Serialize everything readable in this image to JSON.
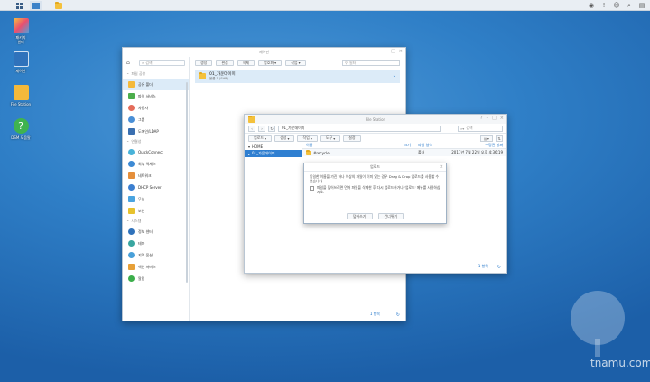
{
  "taskbar": {
    "main_menu_icon": "grid-icon",
    "app_icon": "folder-icon",
    "right_icons": [
      "chat-icon",
      "notification-icon",
      "user-icon",
      "search-icon",
      "widget-icon"
    ]
  },
  "desktop": {
    "icons": [
      {
        "label": "패키지\n센터",
        "icon": "package-center-icon"
      },
      {
        "label": "제어판",
        "icon": "control-panel-icon"
      },
      {
        "label": "File Station",
        "icon": "file-station-icon"
      },
      {
        "label": "DSM 도움말",
        "icon": "help-icon"
      }
    ],
    "watermark": "tnamu.com"
  },
  "control_panel": {
    "title": "제어판",
    "search_placeholder": "검색",
    "sections": [
      {
        "label": "파일 공유",
        "items": [
          "공유 폴더",
          "파일 서비스",
          "사용자",
          "그룹",
          "도메인/LDAP"
        ]
      },
      {
        "label": "연결성",
        "items": [
          "QuickConnect",
          "외부 액세스",
          "네트워크",
          "DHCP Server",
          "무선",
          "보안"
        ]
      },
      {
        "label": "시스템",
        "items": [
          "정보 센터",
          "테마",
          "지역 옵션",
          "색인 서비스",
          "알림"
        ]
      }
    ],
    "active_item": "공유 폴더",
    "toolbar": {
      "create": "생성",
      "edit": "편집",
      "delete": "삭제",
      "encrypt": "암호화",
      "action": "작업"
    },
    "filter_placeholder": "필터",
    "share": {
      "name": "01_가운데이미",
      "sub": "볼륨 1 (SHR)"
    },
    "pager": "1 항목"
  },
  "file_station": {
    "title": "File Station",
    "path": "01_가운데이미",
    "search_placeholder": "검색",
    "toolbar": {
      "upload": "업로드",
      "create": "생성",
      "action": "작업",
      "tools": "도구",
      "settings": "설정"
    },
    "tree": {
      "root": "HOME",
      "selected": "01_가운데이미"
    },
    "columns": {
      "name": "이름",
      "size": "크기",
      "type": "파일 형식",
      "modified": "수정된 날짜"
    },
    "rows": [
      {
        "name": "#recycle",
        "size": "",
        "type": "폴더",
        "modified": "2017년 7월 22일 오후 4:36:19"
      }
    ],
    "pager": "1 항목"
  },
  "dialog": {
    "title": "업로드",
    "message": "동일한 이름을 가진 하나 이상의 파일이 이미 있는 경우 Drag & Drop 업로드를 사용할 수 없습니다.",
    "checkbox_label": "파일을 덮어쓰려면 먼저 파일을 삭제한 후 다시 업로드하거나 '업로드' 메뉴를 사용하십시오.",
    "ok_label": "덮어쓰기",
    "cancel_label": "건너뛰기"
  }
}
